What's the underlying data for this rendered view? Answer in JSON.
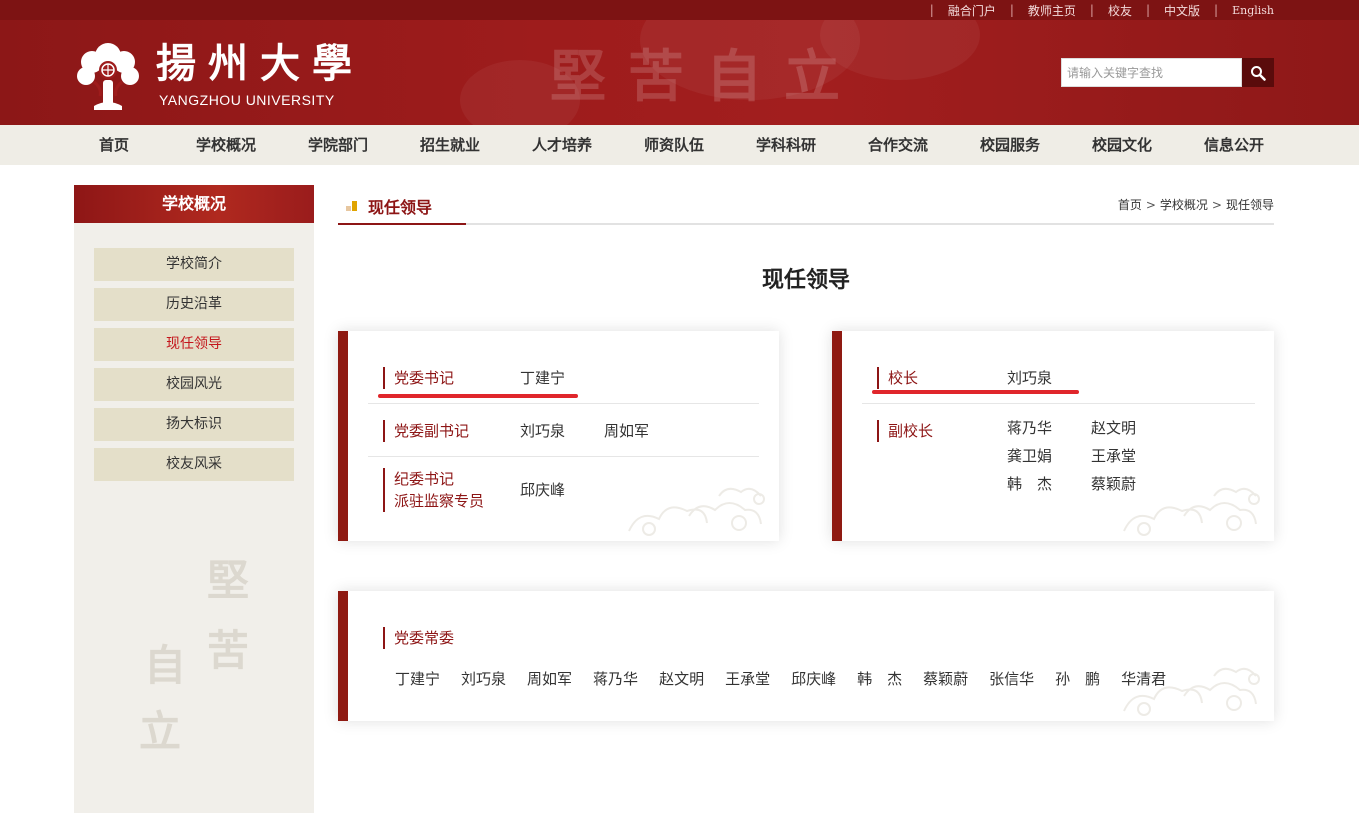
{
  "top_links": [
    "融合门户",
    "教师主页",
    "校友",
    "中文版",
    "English"
  ],
  "logo": {
    "cn": "揚州大學",
    "en": "YANGZHOU UNIVERSITY"
  },
  "header_motto": "堅苦自立",
  "search": {
    "placeholder": "请输入关键字查找"
  },
  "nav": [
    "首页",
    "学校概况",
    "学院部门",
    "招生就业",
    "人才培养",
    "师资队伍",
    "学科科研",
    "合作交流",
    "校园服务",
    "校园文化",
    "信息公开"
  ],
  "sidebar": {
    "title": "学校概况",
    "items": [
      "学校简介",
      "历史沿革",
      "现任领导",
      "校园风光",
      "扬大标识",
      "校友风采"
    ],
    "active_item": "现任领导",
    "motto": [
      "堅",
      "苦",
      "自",
      "立"
    ]
  },
  "breadcrumb": {
    "section_title": "现任领导",
    "path": [
      "首页",
      "学校概况",
      "现任领导"
    ]
  },
  "page_title": "现任领导",
  "party_card": {
    "rows": [
      {
        "role": "党委书记",
        "names": [
          "丁建宁"
        ]
      },
      {
        "role": "党委副书记",
        "names": [
          "刘巧泉",
          "周如军"
        ]
      },
      {
        "role_lines": [
          "纪委书记",
          "派驻监察专员"
        ],
        "names": [
          "邱庆峰"
        ]
      }
    ]
  },
  "president_card": {
    "rows": [
      {
        "role": "校长",
        "names": [
          "刘巧泉"
        ]
      },
      {
        "role": "副校长",
        "names": [
          "蒋乃华",
          "赵文明",
          "龚卫娟",
          "王承堂",
          "韩　杰",
          "蔡颖蔚"
        ]
      }
    ]
  },
  "standing_card": {
    "role": "党委常委",
    "names": [
      "丁建宁",
      "刘巧泉",
      "周如军",
      "蒋乃华",
      "赵文明",
      "王承堂",
      "邱庆峰",
      "韩　杰",
      "蔡颖蔚",
      "张信华",
      "孙　鹏",
      "华清君"
    ]
  },
  "colors": {
    "brand_red": "#8d1515",
    "highlight_red": "#e0262b",
    "nav_bg": "#efede6",
    "sidebar_item_bg": "#e4dfc9"
  }
}
